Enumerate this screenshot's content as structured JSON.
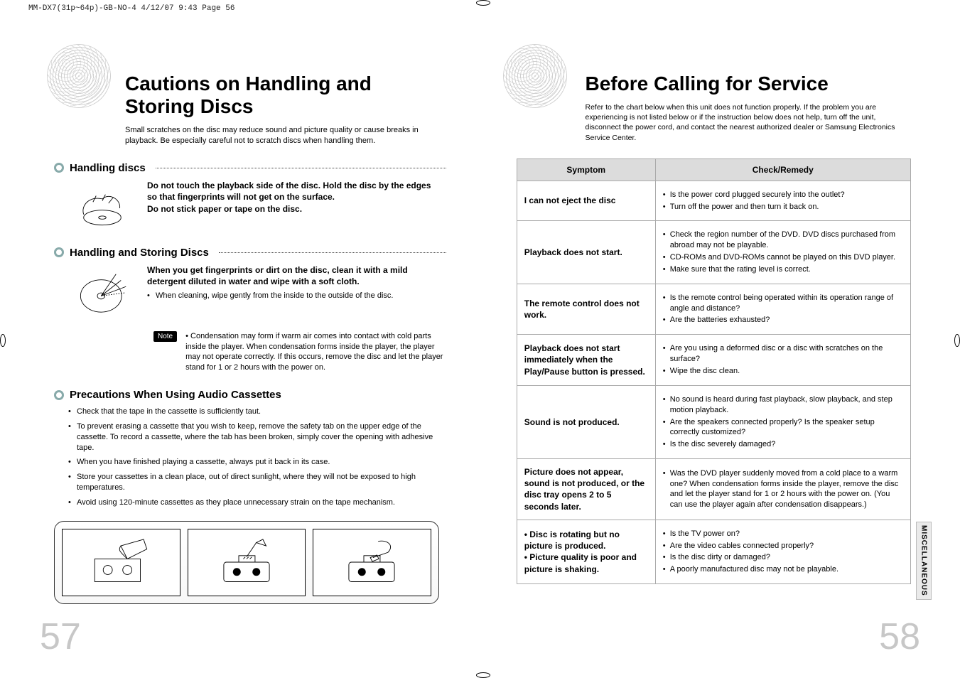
{
  "meta": {
    "header_line": "MM-DX7(31p~64p)-GB-NO-4   4/12/07   9:43   Page 56"
  },
  "left": {
    "title": "Cautions on Handling and Storing Discs",
    "intro": "Small scratches on the disc may reduce sound and picture quality or cause breaks in playback. Be especially careful not to scratch discs when handling them.",
    "section1": {
      "heading": "Handling discs",
      "bold1": "Do not touch the playback side of the disc. Hold the disc by the edges so that fingerprints will not get on the surface.",
      "bold2": "Do not stick paper or tape on the disc."
    },
    "section2": {
      "heading": "Handling and Storing Discs",
      "bold1": "When you get fingerprints or dirt on the disc, clean it with a mild detergent diluted in water and wipe with a soft cloth.",
      "bullet1": "When cleaning, wipe gently from the inside to the outside of the disc.",
      "note_label": "Note",
      "note_text": "Condensation may form if warm air comes into contact with cold parts inside the player. When condensation forms inside the player, the player may not operate correctly. If this occurs, remove the disc and let the player stand for 1 or 2 hours with the power on."
    },
    "section3": {
      "heading": "Precautions When Using Audio Cassettes",
      "items": [
        "Check that the tape in the cassette is sufficiently taut.",
        "To prevent erasing a cassette that you wish to keep, remove the safety tab on the upper edge of the cassette. To record a cassette, where  the tab has been broken, simply cover the opening with adhesive tape.",
        "When you have finished playing a cassette, always put it back in its case.",
        "Store your cassettes in a clean place, out of direct sunlight, where they will not be exposed to high temperatures.",
        "Avoid using 120-minute cassettes as they place unnecessary strain on the tape mechanism."
      ]
    },
    "page_number": "57"
  },
  "right": {
    "title": "Before Calling for Service",
    "intro": "Refer to the chart below when this unit does not function properly. If the problem you are experiencing is not listed below or if the instruction below does not help, turn off the unit, disconnect the power cord, and contact the nearest authorized dealer or Samsung Electronics Service Center.",
    "table_headers": {
      "symptom": "Symptom",
      "remedy": "Check/Remedy"
    },
    "rows": [
      {
        "symptom": "I can not eject the disc",
        "remedies": [
          "Is the power cord plugged securely into the outlet?",
          "Turn off the power and then turn it back on."
        ]
      },
      {
        "symptom": "Playback does not start.",
        "remedies": [
          "Check the region number of the DVD. DVD discs purchased from abroad may not be playable.",
          "CD-ROMs and DVD-ROMs cannot be played on this DVD player.",
          "Make sure that the rating level is correct."
        ]
      },
      {
        "symptom": "The remote control does not work.",
        "remedies": [
          "Is the remote control being operated within its operation range of angle and distance?",
          "Are the batteries exhausted?"
        ]
      },
      {
        "symptom": "Playback does not start immediately when the Play/Pause button is pressed.",
        "remedies": [
          "Are you using a deformed disc or a disc with scratches on the surface?",
          "Wipe the disc clean."
        ]
      },
      {
        "symptom": "Sound is not produced.",
        "remedies": [
          "No sound is heard during fast playback, slow playback, and step motion playback.",
          "Are the speakers connected properly? Is the speaker setup correctly customized?",
          "Is the disc severely damaged?"
        ]
      },
      {
        "symptom": "Picture does not appear, sound is not produced, or the disc tray opens 2 to 5 seconds later.",
        "remedies": [
          "Was the DVD player suddenly moved from a cold place to a warm one? When condensation forms inside the player, remove the disc and let the player stand for 1 or 2 hours with the power on. (You can use the player again after condensation disappears.)"
        ]
      },
      {
        "symptom": "• Disc is rotating but no picture is produced.\n• Picture quality is poor and picture is shaking.",
        "remedies": [
          "Is the TV power on?",
          "Are the video cables connected properly?",
          "Is the disc dirty or damaged?",
          "A poorly manufactured disc may not be playable."
        ]
      }
    ],
    "side_tab": "MISCELLANEOUS",
    "page_number": "58"
  }
}
